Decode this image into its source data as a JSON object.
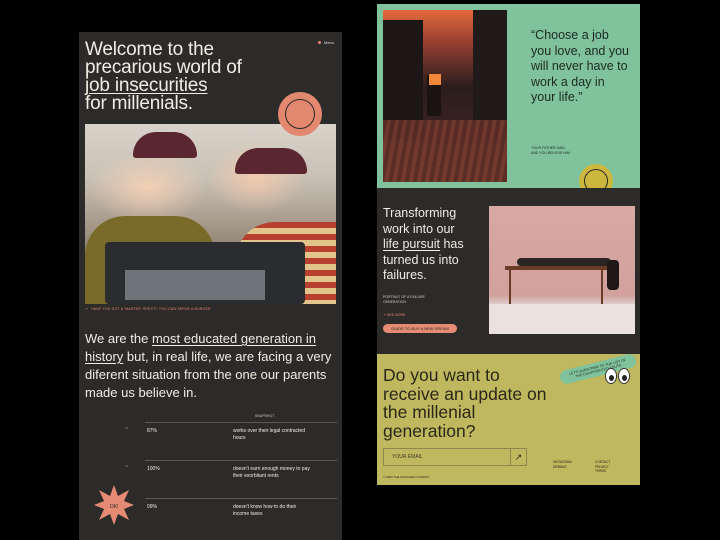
{
  "left": {
    "menu": "Menu",
    "hero": {
      "line1": "Welcome to the",
      "line2": "precarious world of",
      "line3": "job insecurities",
      "line4": "for millenials."
    },
    "photo_caption": "HAVE YOU GOT A 'MASTER' SPEXT? YOU CAN SERVE A BURGER",
    "statement": {
      "part1": "We are the ",
      "link": "most educated generation in history",
      "part2": " but, in real life, we are facing  a very diferent situation from the one our parents made us believe in."
    },
    "stats": {
      "header": "SNAPSHOT",
      "rows": [
        {
          "index": "01",
          "value": "87%",
          "desc": "works over their legal contracted hours"
        },
        {
          "index": "02",
          "value": "100%",
          "desc": "doesn't earn enough money to pay their exorbitant rents"
        },
        {
          "index": "03",
          "value": "99%",
          "desc": "doesn't know how to do their income taxes"
        }
      ]
    },
    "star_label": "OK!",
    "colors": {
      "panel": "#2c2b29",
      "accent": "#e58a73",
      "text": "#f1ece4"
    }
  },
  "right": {
    "quote": "“Choose a job you love, and you will never have to work a day in your life.”",
    "quote_attr": [
      "YOUR FATHER SAID,",
      "AND YOU BELIEVE HIM"
    ],
    "section2": {
      "line1": "Transforming work into our",
      "link": "life pursuit",
      "line2": " has turned us into failures."
    },
    "portrait_caption": [
      "PORTRAIT OF A FAILURE",
      "GENERATION"
    ],
    "link2": "↗ SEE MORE",
    "pill_button": "GUIDE TO BUY A NEW DREAM",
    "newsletter": {
      "title": "Do you want to receive an update on the millenial generation?",
      "subscribe_pill": "LET'S SUBSCRIBE TO THE LIST OF THE DISAPPOINTED YOUTH",
      "email_placeholder": "YOUR EMAIL",
      "footer_col1": [
        "INSTAGRAM",
        "DRIBBLE"
      ],
      "footer_col2": [
        "CONTACT",
        "PRIVACY",
        "TERMS"
      ],
      "copyright": "© 2023 THE MANAGED COHORT"
    },
    "colors": {
      "green": "#7fc29b",
      "olive": "#c0b85e",
      "dark": "#2c2b29",
      "accent": "#e58a73"
    }
  }
}
